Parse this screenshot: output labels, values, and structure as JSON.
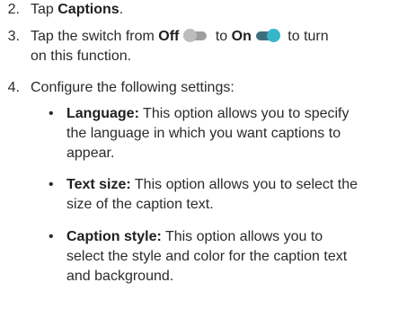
{
  "steps": [
    {
      "number": "2.",
      "pre": "Tap ",
      "bold": "Captions",
      "post": "."
    },
    {
      "number": "3.",
      "pre": "Tap the switch from ",
      "bold_off": "Off",
      "mid": " to ",
      "bold_on": "On",
      "line1_end": " to turn",
      "line2": "on this function."
    },
    {
      "number": "4.",
      "text": "Configure the following settings:"
    }
  ],
  "settings": [
    {
      "label": "Language:",
      "line1": " This option allows you to specify",
      "line2": "the language in which you want captions to",
      "line3": "appear."
    },
    {
      "label": "Text size:",
      "line1": " This option allows you to select the",
      "line2": "size of the caption text."
    },
    {
      "label": "Caption style:",
      "line1": " This option allows you to",
      "line2": "select the style and color for the caption text",
      "line3": "and background."
    }
  ],
  "bullet_char": "•",
  "icons": {
    "toggle_off": "toggle-off-icon",
    "toggle_on": "toggle-on-icon"
  },
  "colors": {
    "text": "#2b2b2b",
    "toggle_on_knob": "#35b7c9",
    "toggle_on_track": "#3f6f7e",
    "toggle_off": "#9e9e9e"
  }
}
